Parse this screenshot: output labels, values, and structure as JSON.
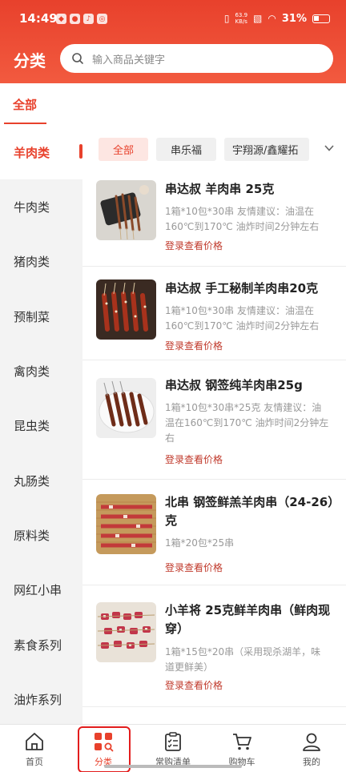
{
  "status_bar": {
    "time": "14:49",
    "netspeed_value": "63.9",
    "netspeed_unit": "KB/s",
    "battery": "31%"
  },
  "header": {
    "title": "分类",
    "search_placeholder": "输入商品关键字"
  },
  "top_tab": {
    "label": "全部"
  },
  "sidebar": {
    "items": [
      {
        "label": "羊肉类"
      },
      {
        "label": "牛肉类"
      },
      {
        "label": "猪肉类"
      },
      {
        "label": "预制菜"
      },
      {
        "label": "禽肉类"
      },
      {
        "label": "昆虫类"
      },
      {
        "label": "丸肠类"
      },
      {
        "label": "原料类"
      },
      {
        "label": "网红小串"
      },
      {
        "label": "素食系列"
      },
      {
        "label": "油炸系列"
      }
    ]
  },
  "brand_chips": [
    {
      "label": "全部"
    },
    {
      "label": "串乐福"
    },
    {
      "label": "宇翔源/鑫耀拓"
    }
  ],
  "products": [
    {
      "name": "串达叔 羊肉串 25克",
      "desc": "1箱*10包*30串 友情建议：油温在160℃到170℃ 油炸时间2分钟左右",
      "price_text": "登录查看价格"
    },
    {
      "name": "串达叔 手工秘制羊肉串20克",
      "desc": "1箱*10包*30串 友情建议：油温在160℃到170℃ 油炸时间2分钟左右",
      "price_text": "登录查看价格"
    },
    {
      "name": "串达叔 钢签纯羊肉串25g",
      "desc": "1箱*10包*30串*25克 友情建议：油温在160℃到170℃ 油炸时间2分钟左右",
      "price_text": "登录查看价格"
    },
    {
      "name": "北串 钢签鲜羔羊肉串（24-26）克",
      "desc": "1箱*20包*25串",
      "price_text": "登录查看价格"
    },
    {
      "name": "小羊将 25克鲜羊肉串（鲜肉现穿）",
      "desc": "1箱*15包*20串（采用现杀湖羊，味道更鲜美）",
      "price_text": "登录查看价格"
    }
  ],
  "bottom_nav": [
    {
      "label": "首页"
    },
    {
      "label": "分类"
    },
    {
      "label": "常购清单"
    },
    {
      "label": "购物车"
    },
    {
      "label": "我的"
    }
  ],
  "colors": {
    "accent": "#e8412c",
    "price": "#c0392b"
  }
}
